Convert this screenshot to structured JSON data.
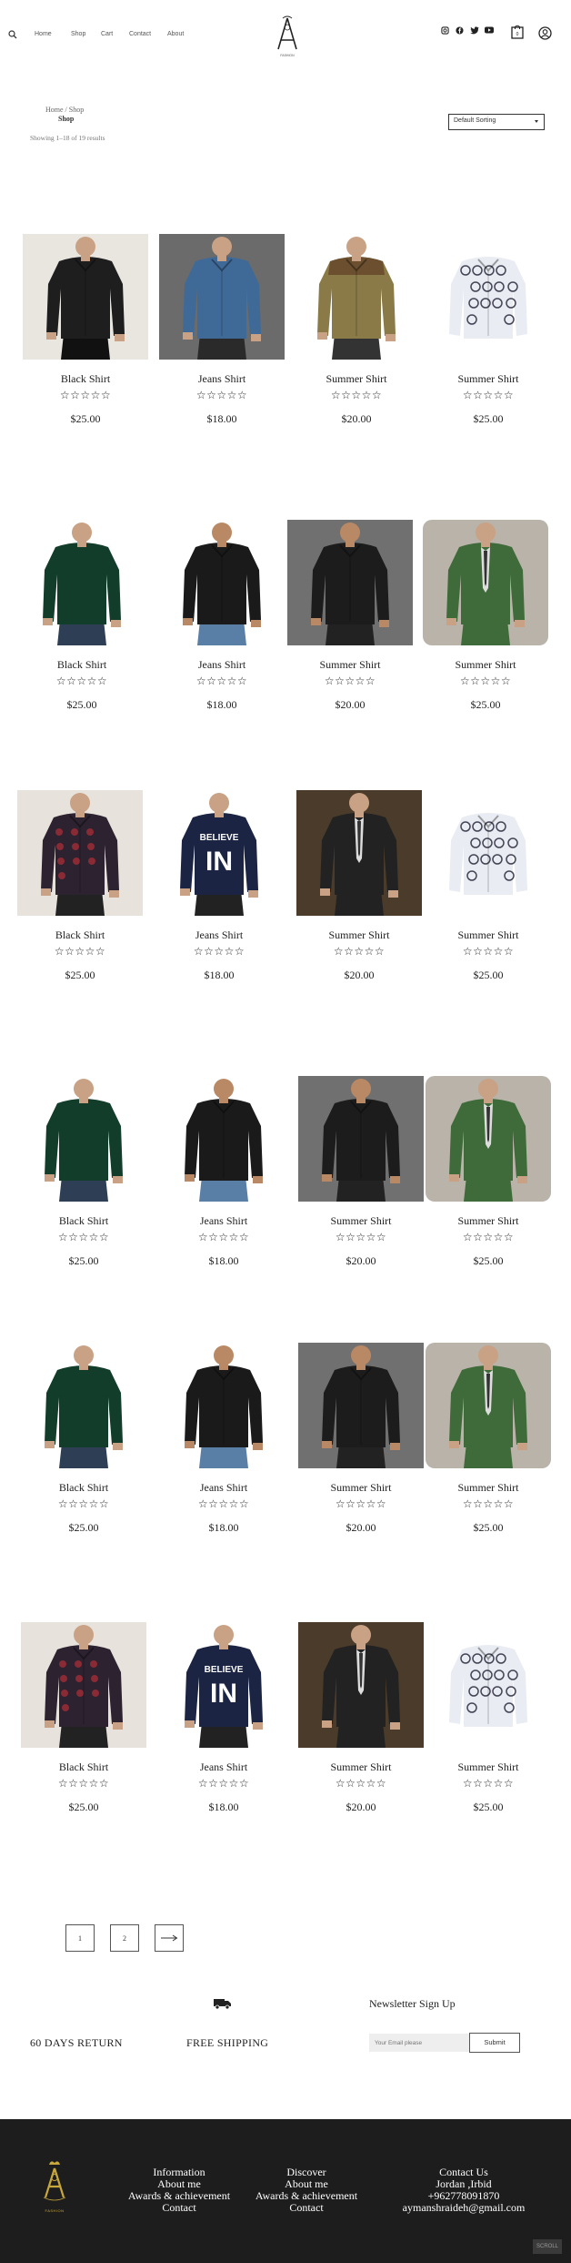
{
  "nav": {
    "items": [
      "Home",
      "Shop",
      "Cart",
      "Contact",
      "About"
    ]
  },
  "breadcrumb": "Home / Shop",
  "page_title": "Shop",
  "results_text": "Showing 1–18 of 19 results",
  "sort": {
    "selected": "Default Sorting"
  },
  "stars": "☆☆☆☆☆",
  "products": [
    {
      "name": "Black Shirt",
      "price": "$25.00",
      "img": "black-shirt"
    },
    {
      "name": "Jeans Shirt",
      "price": "$18.00",
      "img": "denim"
    },
    {
      "name": "Summer Shirt",
      "price": "$20.00",
      "img": "khaki"
    },
    {
      "name": "Summer Shirt",
      "price": "$25.00",
      "img": "floral"
    },
    {
      "name": "Black Shirt",
      "price": "$25.00",
      "img": "green-tee"
    },
    {
      "name": "Jeans Shirt",
      "price": "$18.00",
      "img": "black-polo"
    },
    {
      "name": "Summer Shirt",
      "price": "$20.00",
      "img": "black-short"
    },
    {
      "name": "Summer Shirt",
      "price": "$25.00",
      "img": "green-suit"
    },
    {
      "name": "Black Shirt",
      "price": "$25.00",
      "img": "print-shirt"
    },
    {
      "name": "Jeans Shirt",
      "price": "$18.00",
      "img": "believe-tee"
    },
    {
      "name": "Summer Shirt",
      "price": "$20.00",
      "img": "suit"
    },
    {
      "name": "Summer Shirt",
      "price": "$25.00",
      "img": "floral"
    },
    {
      "name": "Black Shirt",
      "price": "$25.00",
      "img": "green-tee"
    },
    {
      "name": "Jeans Shirt",
      "price": "$18.00",
      "img": "black-polo"
    },
    {
      "name": "Summer Shirt",
      "price": "$20.00",
      "img": "black-short"
    },
    {
      "name": "Summer Shirt",
      "price": "$25.00",
      "img": "green-suit"
    },
    {
      "name": "Black Shirt",
      "price": "$25.00",
      "img": "green-tee"
    },
    {
      "name": "Jeans Shirt",
      "price": "$18.00",
      "img": "black-polo"
    },
    {
      "name": "Summer Shirt",
      "price": "$20.00",
      "img": "black-short"
    },
    {
      "name": "Summer Shirt",
      "price": "$25.00",
      "img": "green-suit"
    },
    {
      "name": "Black Shirt",
      "price": "$25.00",
      "img": "print-shirt"
    },
    {
      "name": "Jeans Shirt",
      "price": "$18.00",
      "img": "believe-tee"
    },
    {
      "name": "Summer Shirt",
      "price": "$20.00",
      "img": "suit"
    },
    {
      "name": "Summer Shirt",
      "price": "$25.00",
      "img": "floral"
    }
  ],
  "pagination": {
    "pages": [
      "1",
      "2"
    ],
    "next_icon": "arrow-right-icon"
  },
  "features": {
    "returns": "60 DAYS RETURN",
    "shipping": "FREE SHIPPING",
    "shipping_icon": "truck-icon"
  },
  "newsletter": {
    "title": "Newsletter Sign Up",
    "placeholder": "Your Email please",
    "button": "Submit"
  },
  "footer": {
    "logo_text": "FASHION",
    "col1": [
      "Information",
      "About me",
      "Awards & achievement",
      "Contact"
    ],
    "col2": [
      "Discover",
      "About me",
      "Awards & achievement",
      "Contact"
    ],
    "col3": [
      "Contact Us",
      "Jordan ,Irbid",
      "+962778091870",
      "aymanshraideh@gmail.com"
    ],
    "scroll_label": "SCROLL"
  },
  "colors": {
    "footer_bg": "#1d1d1d",
    "text": "#222222",
    "logo_gold": "#c8a83c"
  }
}
